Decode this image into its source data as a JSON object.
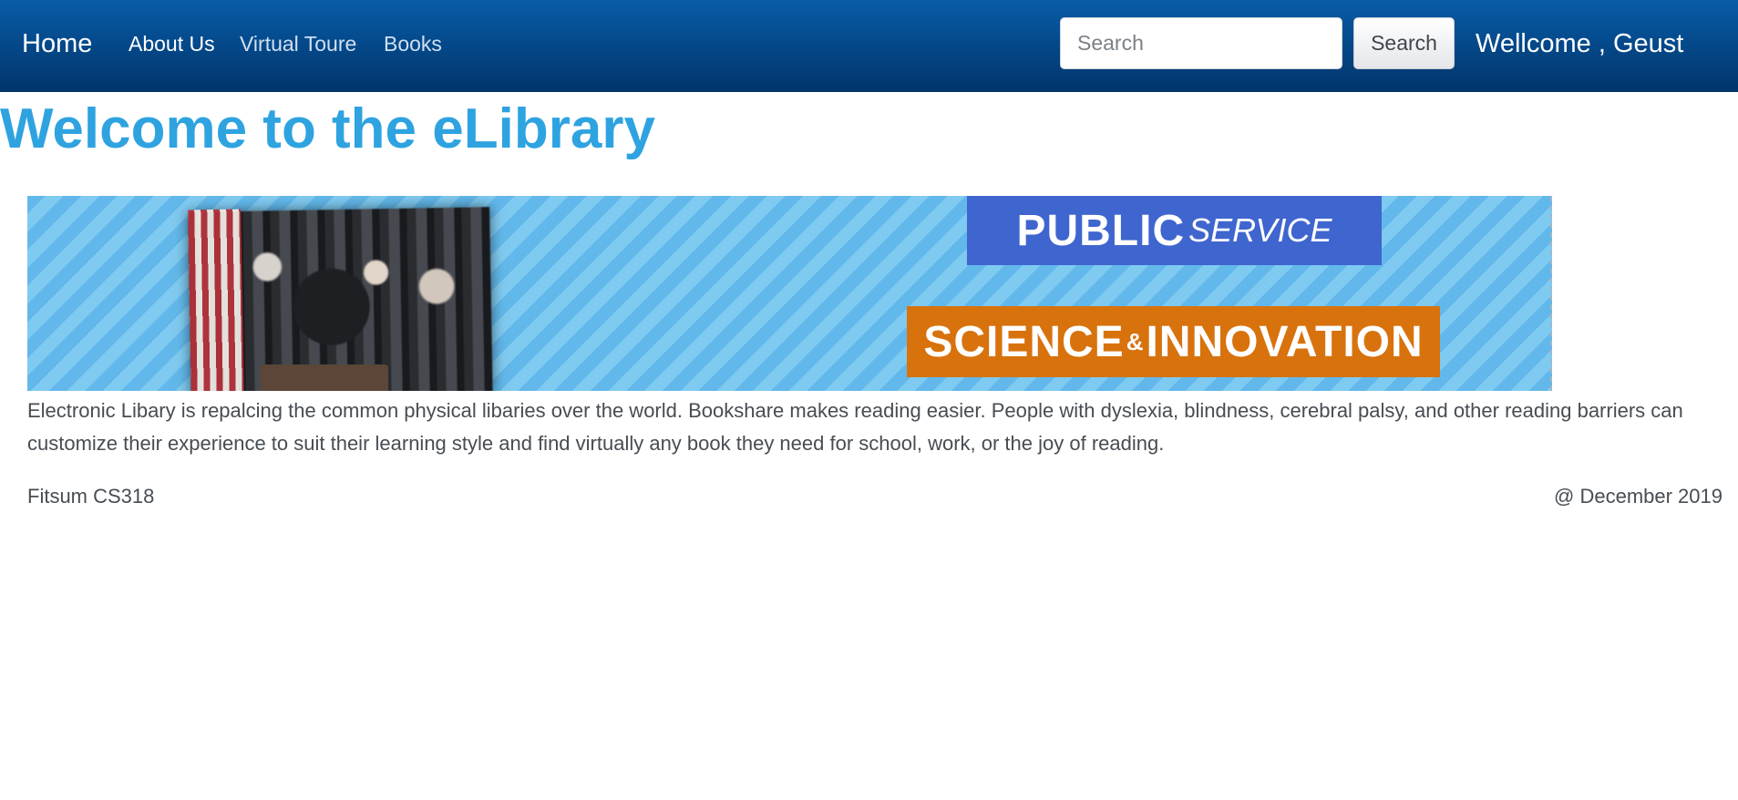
{
  "navbar": {
    "brand": "Home",
    "links": [
      {
        "label": "About Us"
      },
      {
        "label": "Virtual Toure"
      },
      {
        "label": "Books"
      }
    ],
    "search": {
      "placeholder": "Search",
      "value": "",
      "button_label": "Search"
    },
    "greeting": "Wellcome , Geust",
    "colors": {
      "background": "#044a8c",
      "text": "#ffffff"
    }
  },
  "main": {
    "title": "Welcome to the eLibrary",
    "title_color": "#2ea3e0",
    "banner": {
      "tag_primary_bold": "PUBLIC",
      "tag_primary_rest": "SERVICE",
      "tag_secondary_left": "SCIENCE",
      "tag_secondary_amp": "&",
      "tag_secondary_right": "INNOVATION",
      "colors": {
        "background": "#62b8ea",
        "primary_tag": "#3f65cf",
        "secondary_tag": "#d8720d"
      }
    },
    "intro": "Electronic Libary is repalcing the common physical libaries over the world. Bookshare makes reading easier. People with dyslexia, blindness, cerebral palsy, and other reading barriers can customize their experience to suit their learning style and find virtually any book they need for school, work, or the joy of reading."
  },
  "footer": {
    "left": "Fitsum CS318",
    "right": "@ December 2019"
  }
}
